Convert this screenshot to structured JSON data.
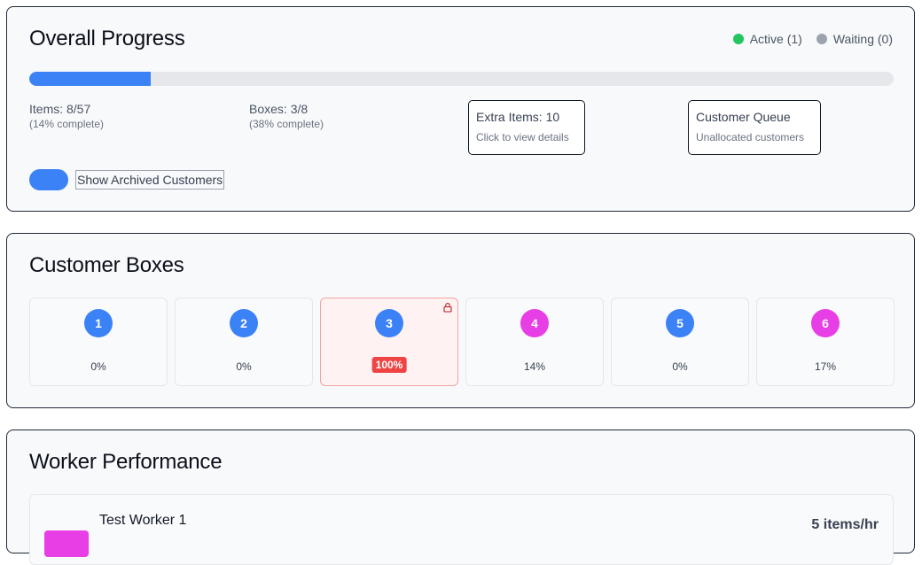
{
  "progress": {
    "title": "Overall Progress",
    "legend": [
      {
        "label": "Active (1)",
        "color": "#22c55e"
      },
      {
        "label": "Waiting (0)",
        "color": "#9ca3af"
      }
    ],
    "fraction_complete": 0.14,
    "items": {
      "label": "Items: 8/57",
      "sub": "(14% complete)"
    },
    "boxes": {
      "label": "Boxes: 3/8",
      "sub": "(38% complete)"
    },
    "extra_items": {
      "title": "Extra Items: 10",
      "sub": "Click to view details"
    },
    "customer_queue": {
      "title": "Customer Queue",
      "sub": "Unallocated customers"
    },
    "toggle": {
      "label": "Show Archived Customers",
      "on": true
    }
  },
  "customer_boxes": {
    "title": "Customer Boxes",
    "boxes": [
      {
        "number": "1",
        "percent": "0%",
        "color": "#3b82f6",
        "full": false,
        "locked": false
      },
      {
        "number": "2",
        "percent": "0%",
        "color": "#3b82f6",
        "full": false,
        "locked": false
      },
      {
        "number": "3",
        "percent": "100%",
        "color": "#3b82f6",
        "full": true,
        "locked": true
      },
      {
        "number": "4",
        "percent": "14%",
        "color": "#e83ee5",
        "full": false,
        "locked": false
      },
      {
        "number": "5",
        "percent": "0%",
        "color": "#3b82f6",
        "full": false,
        "locked": false
      },
      {
        "number": "6",
        "percent": "17%",
        "color": "#e83ee5",
        "full": false,
        "locked": false
      }
    ]
  },
  "workers": {
    "title": "Worker Performance",
    "list": [
      {
        "name": "Test Worker 1",
        "rate": "5 items/hr",
        "color": "#e83ee5"
      }
    ]
  }
}
